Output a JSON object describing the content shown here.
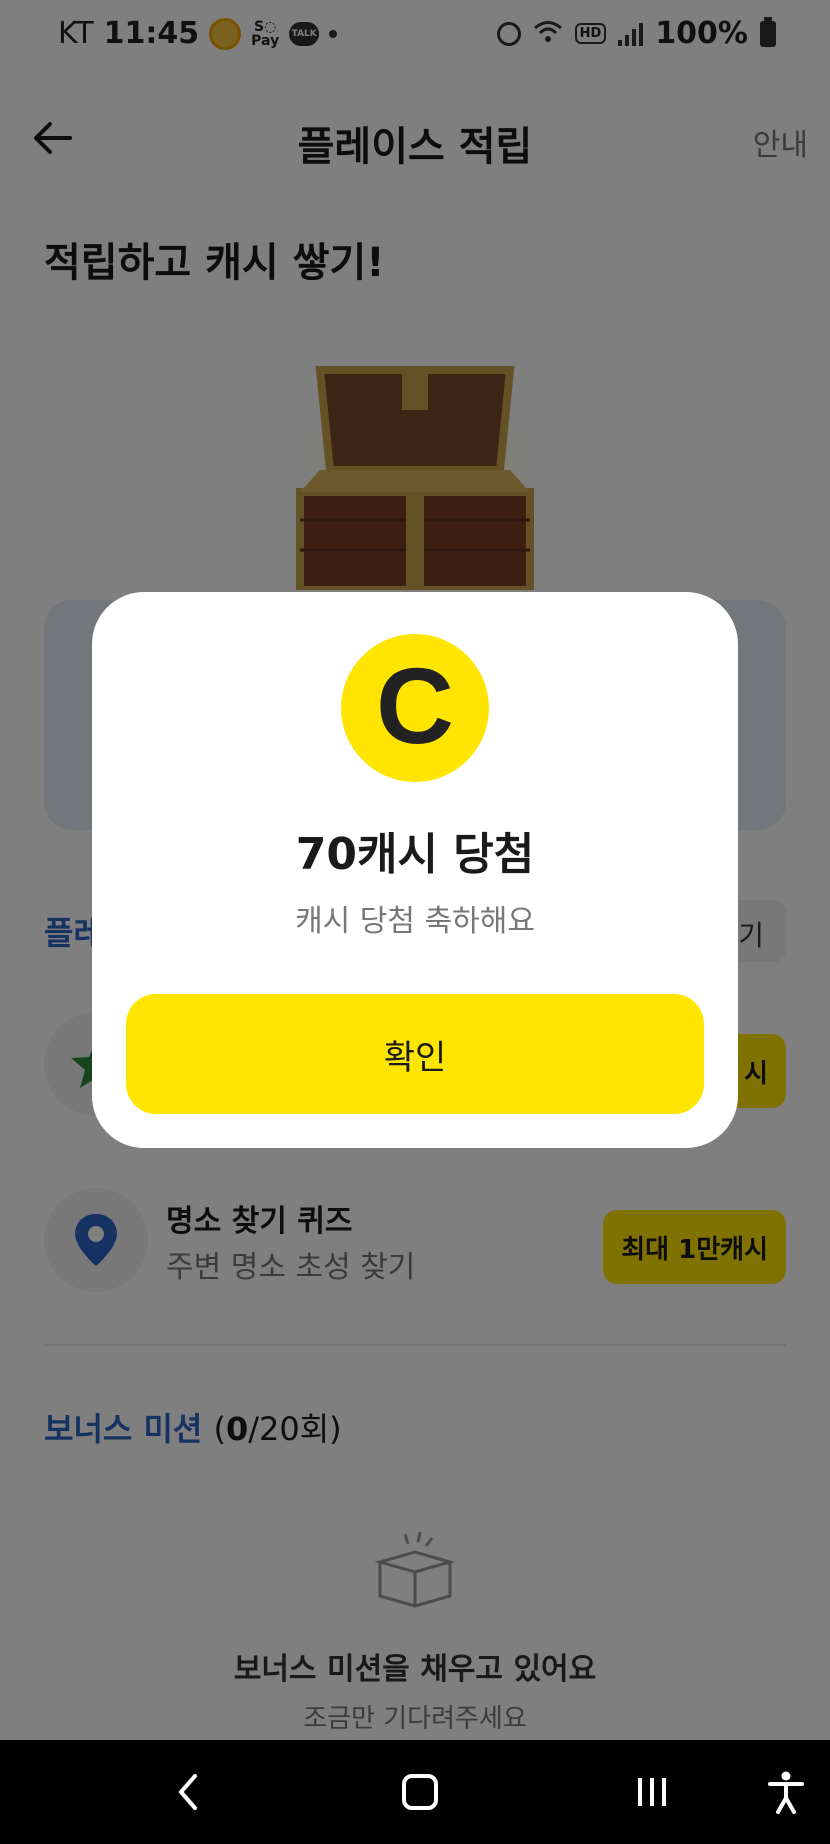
{
  "status_bar": {
    "carrier": "KT",
    "time": "11:45",
    "pay_label": "Pay",
    "talk_label": "TALK",
    "hd_label": "HD",
    "battery": "100%"
  },
  "header": {
    "title": "플레이스 적립",
    "guide": "안내"
  },
  "hero": {
    "title": "적립하고 캐시 쌓기!"
  },
  "section": {
    "title_partial": "플레",
    "button_partial": "기"
  },
  "missions": [
    {
      "title": "",
      "subtitle": "",
      "badge": "시"
    },
    {
      "title": "명소 찾기 퀴즈",
      "subtitle": "주변 명소 초성 찾기",
      "badge": "최대 1만캐시"
    }
  ],
  "bonus": {
    "title": "보너스 미션",
    "count_done": "0",
    "count_total": "/20회)",
    "count_open": "(",
    "empty_title": "보너스 미션을 채우고 있어요",
    "empty_sub": "조금만 기다려주세요"
  },
  "modal": {
    "coin_letter": "C",
    "title": "70캐시 당첨",
    "subtitle": "캐시 당첨 축하해요",
    "confirm": "확인"
  },
  "colors": {
    "accent_yellow": "#ffe500",
    "section_blue": "#2a64c5",
    "overlay": "rgba(0,0,0,0.5)"
  }
}
